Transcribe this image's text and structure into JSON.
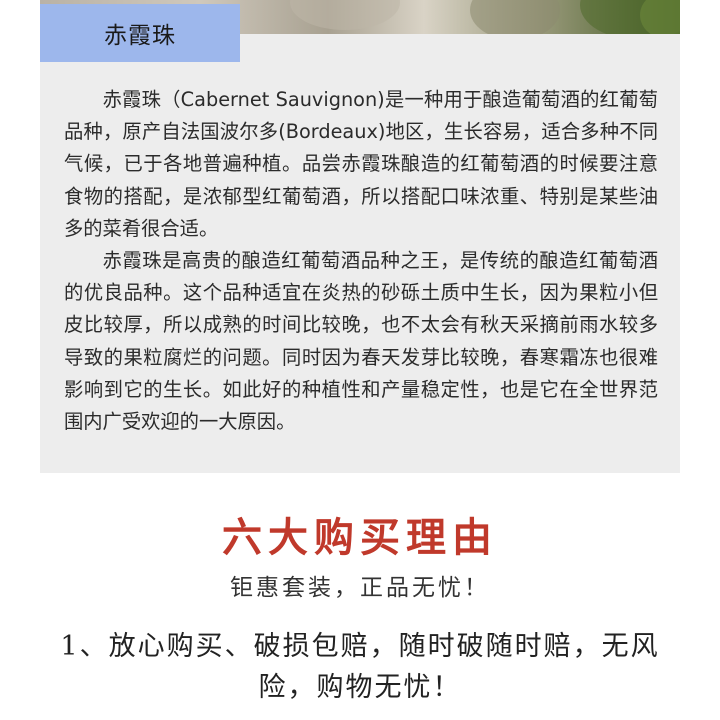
{
  "header": {
    "tab_title": "赤霞珠"
  },
  "description": {
    "paragraphs": [
      "赤霞珠（Cabernet Sauvignon)是一种用于酿造葡萄酒的红葡萄品种，原产自法国波尔多(Bordeaux)地区，生长容易，适合多种不同气候，已于各地普遍种植。品尝赤霞珠酿造的红葡萄酒的时候要注意食物的搭配，是浓郁型红葡萄酒，所以搭配口味浓重、特别是某些油多的菜肴很合适。",
      "赤霞珠是高贵的酿造红葡萄酒品种之王，是传统的酿造红葡萄酒的优良品种。这个品种适宜在炎热的砂砾土质中生长，因为果粒小但皮比较厚，所以成熟的时间比较晚，也不太会有秋天采摘前雨水较多导致的果粒腐烂的问题。同时因为春天发芽比较晚，春寒霜冻也很难影响到它的生长。如此好的种植性和产量稳定性，也是它在全世界范围内广受欢迎的一大原因。"
    ]
  },
  "reasons_section": {
    "title": "六大购买理由",
    "subtitle": "钜惠套装，正品无忧！",
    "first_reason": "1、放心购买、破损包赔，随时破随时赔，无风险，购物无忧！"
  },
  "colors": {
    "tab_background": "#9db7ec",
    "panel_background": "#ededed",
    "heading_red": "#c0392b"
  }
}
